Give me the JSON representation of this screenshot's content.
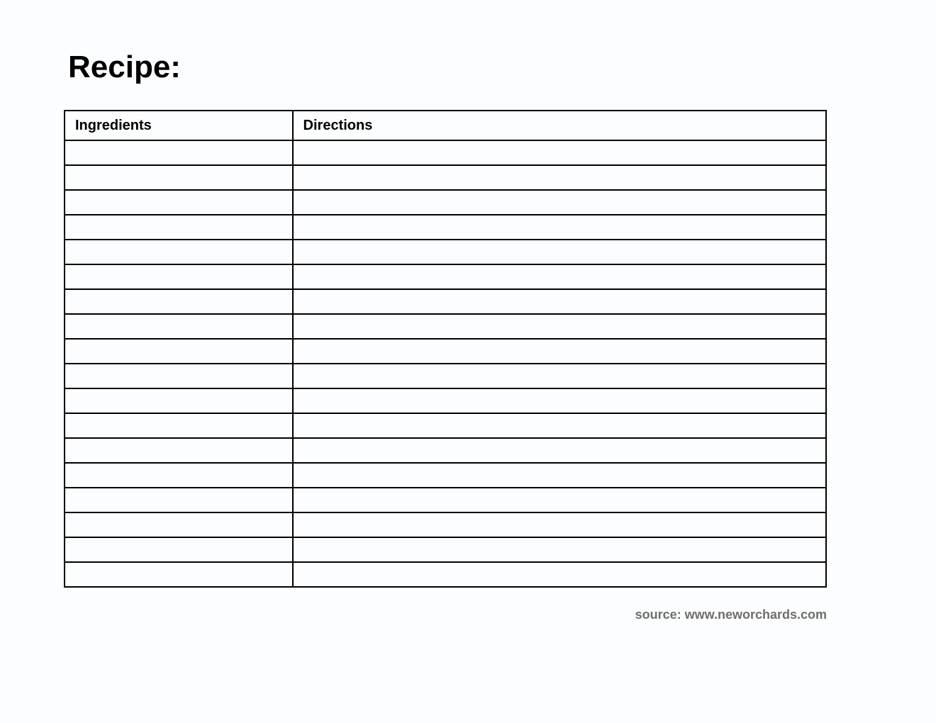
{
  "title": "Recipe:",
  "columns": {
    "ingredients": "Ingredients",
    "directions": "Directions"
  },
  "rows": [
    {
      "ingredients": "",
      "directions": ""
    },
    {
      "ingredients": "",
      "directions": ""
    },
    {
      "ingredients": "",
      "directions": ""
    },
    {
      "ingredients": "",
      "directions": ""
    },
    {
      "ingredients": "",
      "directions": ""
    },
    {
      "ingredients": "",
      "directions": ""
    },
    {
      "ingredients": "",
      "directions": ""
    },
    {
      "ingredients": "",
      "directions": ""
    },
    {
      "ingredients": "",
      "directions": ""
    },
    {
      "ingredients": "",
      "directions": ""
    },
    {
      "ingredients": "",
      "directions": ""
    },
    {
      "ingredients": "",
      "directions": ""
    },
    {
      "ingredients": "",
      "directions": ""
    },
    {
      "ingredients": "",
      "directions": ""
    },
    {
      "ingredients": "",
      "directions": ""
    },
    {
      "ingredients": "",
      "directions": ""
    },
    {
      "ingredients": "",
      "directions": ""
    },
    {
      "ingredients": "",
      "directions": ""
    }
  ],
  "source": "source: www.neworchards.com"
}
